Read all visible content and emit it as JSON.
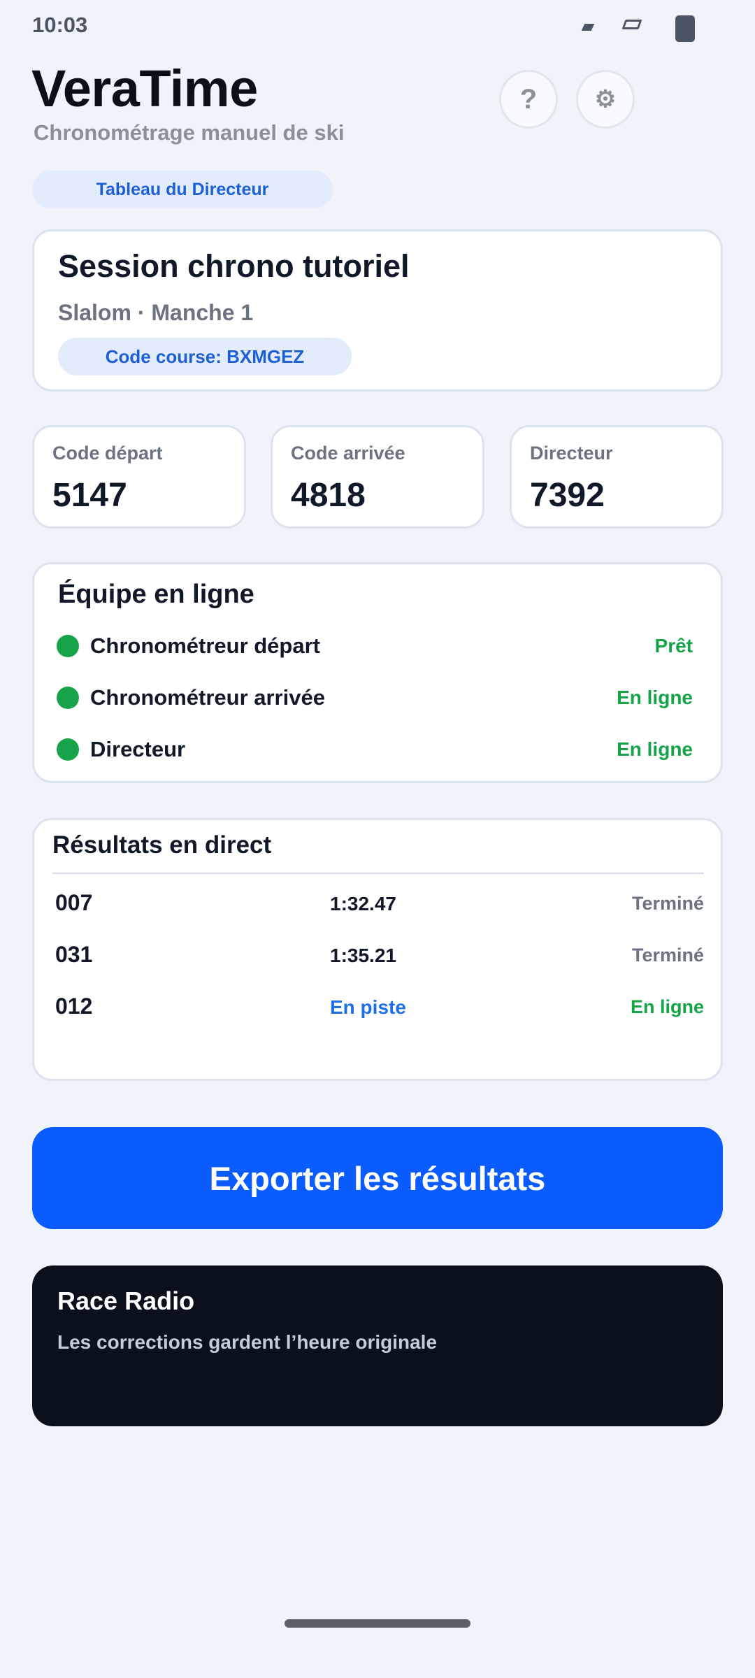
{
  "status_bar": {
    "time": "10:03"
  },
  "app": {
    "title": "VeraTime",
    "subtitle": "Chronométrage manuel de ski"
  },
  "header": {
    "help_icon": "?",
    "settings_icon": "⚙"
  },
  "role": {
    "label": "Tableau du Directeur"
  },
  "session": {
    "title": "Session chrono tutoriel",
    "subtitle": "Slalom · Manche 1",
    "course_code": "Code course: BXMGEZ"
  },
  "codes": [
    {
      "label": "Code départ",
      "value": "5147"
    },
    {
      "label": "Code arrivée",
      "value": "4818"
    },
    {
      "label": "Directeur",
      "value": "7392"
    }
  ],
  "team": {
    "title": "Équipe en ligne",
    "members": [
      {
        "name": "Chronométreur départ",
        "status": "Prêt"
      },
      {
        "name": "Chronométreur arrivée",
        "status": "En ligne"
      },
      {
        "name": "Directeur",
        "status": "En ligne"
      }
    ]
  },
  "results": {
    "title": "Résultats en direct",
    "rows": [
      {
        "bib": "007",
        "time": "1:32.47",
        "status": "Terminé"
      },
      {
        "bib": "031",
        "time": "1:35.21",
        "status": "Terminé"
      },
      {
        "bib": "012",
        "time": "En piste",
        "status": "En ligne"
      }
    ]
  },
  "actions": {
    "export_label": "Exporter les résultats"
  },
  "radio": {
    "title": "Race Radio",
    "message": "Les corrections gardent l’heure originale"
  },
  "colors": {
    "accent": "#0b5cff",
    "online_green": "#16a34a",
    "pill_blue": "#1e5fd6",
    "radio_bg": "#0a111c"
  }
}
